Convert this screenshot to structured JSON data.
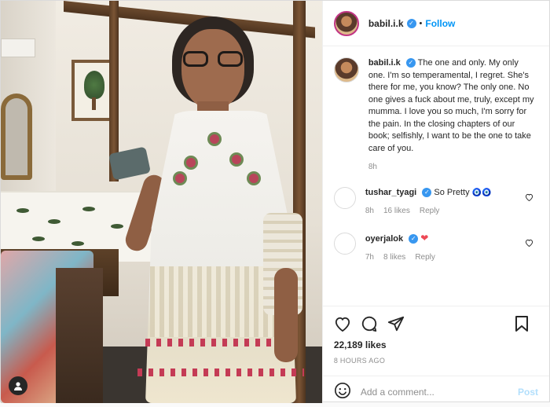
{
  "post": {
    "author": {
      "username": "babil.i.k",
      "verified": true,
      "follow_label": "Follow",
      "separator": "•"
    },
    "caption": {
      "username": "babil.i.k",
      "text": "The one and only. My only one. I'm so temperamental, I regret. She's there for me, you know? The only one. No one gives a fuck about me, truly, except my mumma. I love you so much, I'm sorry for the pain. In the closing chapters of our book; selfishly, I want to be the one to take care of you.",
      "time": "8h"
    },
    "comments": [
      {
        "username": "tushar_tyagi",
        "verified": true,
        "text": "So Pretty",
        "emoji": "🧿🧿",
        "time": "8h",
        "likes": "16 likes",
        "reply_label": "Reply"
      },
      {
        "username": "oyerjalok",
        "verified": true,
        "text": "",
        "emoji": "❤",
        "time": "7h",
        "likes": "8 likes",
        "reply_label": "Reply"
      }
    ],
    "likes_count": "22,189 likes",
    "posted_ago": "8 HOURS AGO",
    "add_comment": {
      "placeholder": "Add a comment...",
      "post_label": "Post"
    },
    "icons": [
      "heart-icon",
      "comment-icon",
      "share-icon",
      "bookmark-icon",
      "emoji-icon",
      "user-tag-icon"
    ],
    "colors": {
      "link": "#0095f6",
      "verified": "#3897f0",
      "post_disabled": "#b2dffc",
      "heart_red": "#ed4956",
      "meta_gray": "#8e8e8e"
    }
  }
}
